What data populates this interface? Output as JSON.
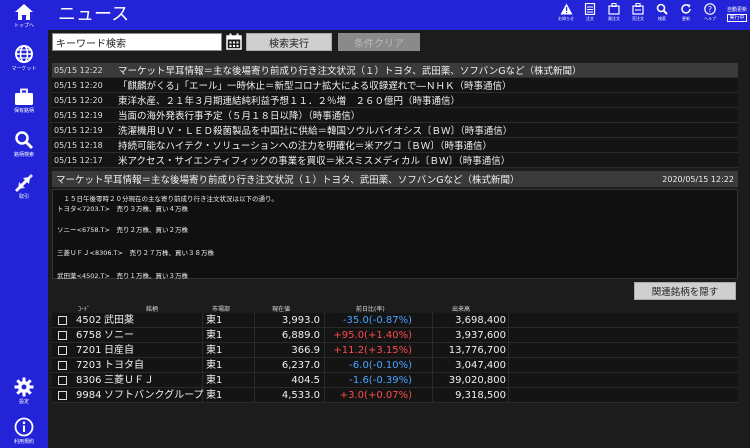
{
  "sidebar": {
    "items": [
      {
        "label": "トップへ",
        "icon": "home-icon"
      },
      {
        "label": "マーケット",
        "icon": "globe-icon"
      },
      {
        "label": "保有銘柄",
        "icon": "briefcase-icon"
      },
      {
        "label": "銘柄検索",
        "icon": "search-icon"
      },
      {
        "label": "取引",
        "icon": "trade-icon"
      }
    ],
    "bottom": [
      {
        "label": "設定",
        "icon": "gear-icon"
      },
      {
        "label": "利用規約",
        "icon": "info-icon"
      }
    ]
  },
  "header": {
    "title": "ニュース",
    "icons": [
      {
        "label": "お知らせ",
        "icon": "alert-icon"
      },
      {
        "label": "注文",
        "icon": "order-icon"
      },
      {
        "label": "買注文",
        "icon": "buy-icon"
      },
      {
        "label": "売注文",
        "icon": "sell-icon"
      },
      {
        "label": "検索",
        "icon": "search-icon"
      },
      {
        "label": "更新",
        "icon": "refresh-icon"
      },
      {
        "label": "ヘルプ",
        "icon": "help-icon"
      }
    ],
    "auto_update_label": "自動更新",
    "auto_update_state": "実行中"
  },
  "search": {
    "value": "キーワード検索",
    "search_button": "検索実行",
    "clear_button": "条件クリア"
  },
  "news": [
    {
      "time": "05/15 12:22",
      "title": "マーケット早耳情報＝主な後場寄り前成り行き注文状況（１）トヨタ、武田薬、ソフバンGなど（株式新聞）",
      "selected": true
    },
    {
      "time": "05/15 12:20",
      "title": "「麒麟がくる」「エール」一時休止＝新型コロナ拡大による収録遅れで―ＮＨＫ（時事通信）",
      "selected": false
    },
    {
      "time": "05/15 12:20",
      "title": "東洋水産、２１年３月期連結純利益予想１１．２％増　２６０億円（時事通信）",
      "selected": false
    },
    {
      "time": "05/15 12:19",
      "title": "当面の海外発表行事予定（５月１８日以降）（時事通信）",
      "selected": false
    },
    {
      "time": "05/15 12:19",
      "title": "洗濯機用ＵＶ・ＬＥＤ殺菌製品を中国社に供給＝韓国ソウルバイオシス〔ＢＷ〕（時事通信）",
      "selected": false
    },
    {
      "time": "05/15 12:18",
      "title": "持続可能なハイテク・ソリューションへの注力を明確化＝米アグコ〔ＢＷ〕（時事通信）",
      "selected": false
    },
    {
      "time": "05/15 12:17",
      "title": "米アクセス・サイエンティフィックの事業を買収＝米スミスメディカル〔ＢＷ〕（時事通信）",
      "selected": false
    }
  ],
  "detail": {
    "title": "マーケット早耳情報＝主な後場寄り前成り行き注文状況（１）トヨタ、武田薬、ソフバンGなど（株式新聞）",
    "date": "2020/05/15 12:22",
    "lines": [
      "　１５日午後零時２０分現在の主な寄り前成り行き注文状況は以下の通り。",
      "トヨタ<7203.T>　売り３万株、買い４万株",
      "ソニー<6758.T>　売り２万株、買い２万株",
      "三菱ＵＦＪ<8306.T>　売り２７万株、買い３８万株",
      "武田薬<4502.T>　売り１万株、買い３万株"
    ]
  },
  "related_button": "関連銘柄を隠す",
  "table": {
    "headers": [
      "ｺｰﾄﾞ",
      "銘柄",
      "市場部",
      "現在値",
      "前日比(率)",
      "出来高"
    ],
    "rows": [
      {
        "code": "4502",
        "name": "武田薬",
        "market": "東1",
        "price": "3,993.0",
        "change": "-35.0(-0.87%)",
        "dir": "neg",
        "volume": "3,698,400"
      },
      {
        "code": "6758",
        "name": "ソニー",
        "market": "東1",
        "price": "6,889.0",
        "change": "+95.0(+1.40%)",
        "dir": "pos",
        "volume": "3,937,600"
      },
      {
        "code": "7201",
        "name": "日産自",
        "market": "東1",
        "price": "366.9",
        "change": "+11.2(+3.15%)",
        "dir": "pos",
        "volume": "13,776,700"
      },
      {
        "code": "7203",
        "name": "トヨタ自",
        "market": "東1",
        "price": "6,237.0",
        "change": "-6.0(-0.10%)",
        "dir": "neg",
        "volume": "3,047,400"
      },
      {
        "code": "8306",
        "name": "三菱ＵＦＪ",
        "market": "東1",
        "price": "404.5",
        "change": "-1.6(-0.39%)",
        "dir": "neg",
        "volume": "39,020,800"
      },
      {
        "code": "9984",
        "name": "ソフトバンクグループ",
        "market": "東1",
        "price": "4,533.0",
        "change": "+3.0(+0.07%)",
        "dir": "pos",
        "volume": "9,318,500"
      }
    ]
  }
}
